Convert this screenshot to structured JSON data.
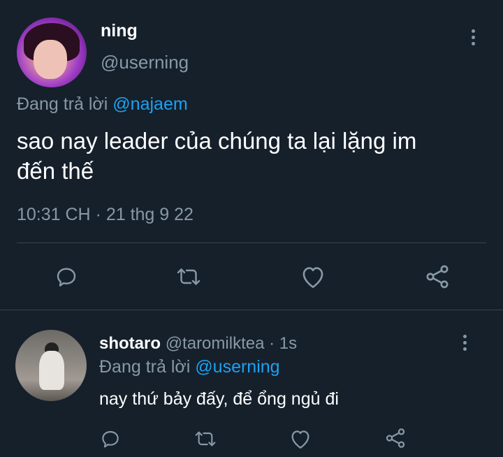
{
  "main_tweet": {
    "display_name": "ning",
    "handle": "@userning",
    "replying_prefix": "Đang trả lời",
    "replying_to": "@najaem",
    "text_line1": "sao nay leader của chúng ta lại lặng im",
    "text_line2": "đến thế",
    "timestamp": "10:31 CH · 21 thg 9 22",
    "icons": [
      "reply-icon",
      "retweet-icon",
      "like-icon",
      "share-icon",
      "more-options-icon"
    ]
  },
  "reply_tweet": {
    "display_name": "shotaro",
    "handle": "@taromilktea",
    "time": "· 1s",
    "replying_prefix": "Đang trả lời",
    "replying_to": "@userning",
    "text": "nay thứ bảy đấy, để ổng ngủ đi",
    "icons": [
      "reply-icon",
      "retweet-icon",
      "like-icon",
      "share-icon",
      "more-options-icon"
    ]
  },
  "colors": {
    "background": "#15202b",
    "text": "#ffffff",
    "muted": "#8899a6",
    "link": "#1da1f2",
    "divider": "#38444d"
  }
}
